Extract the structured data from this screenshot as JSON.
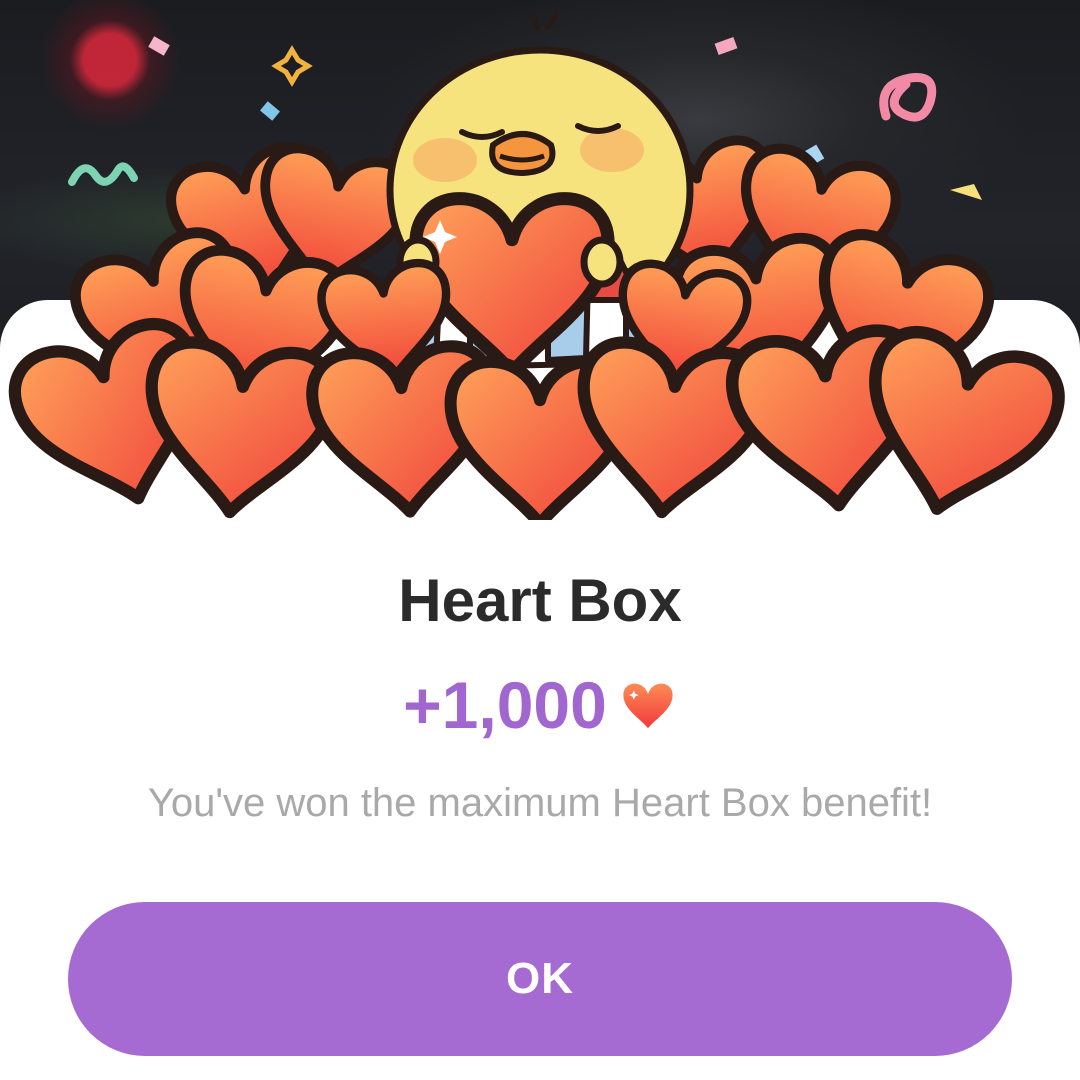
{
  "dialog": {
    "title": "Heart Box",
    "reward_amount": "+1,000",
    "reward_icon": "heart-icon",
    "message": "You've won the maximum Heart Box benefit!",
    "ok_label": "OK"
  },
  "colors": {
    "accent": "#a66ad3",
    "reward_text": "#a266d1",
    "heart_top": "#ff9a55",
    "heart_bottom": "#f2453a",
    "title_text": "#2b2b2b",
    "message_text": "#a9a9a9"
  },
  "illustration": {
    "description_icon": "chick-holding-heart-illustration"
  }
}
